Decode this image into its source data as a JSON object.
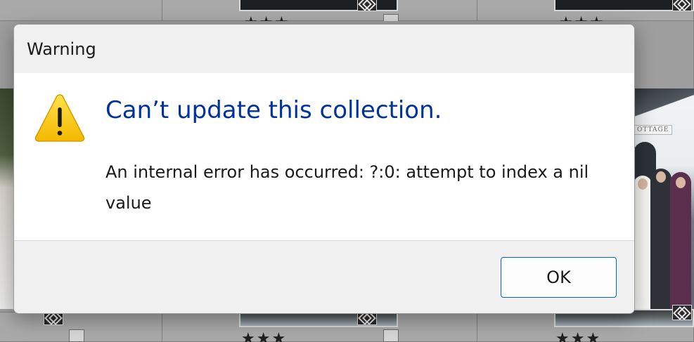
{
  "dialog": {
    "title": "Warning",
    "icon": "warning-triangle-icon",
    "headline": "Can’t update this collection.",
    "message": "An internal error has occurred: ?:0: attempt to index a nil value",
    "ok_label": "OK"
  },
  "background": {
    "photo_sign": "OTTAGE",
    "star_rating": "★★★"
  },
  "colors": {
    "headline": "#003399",
    "button_border": "#0067c0",
    "dialog_chrome": "#f0f0f0"
  }
}
